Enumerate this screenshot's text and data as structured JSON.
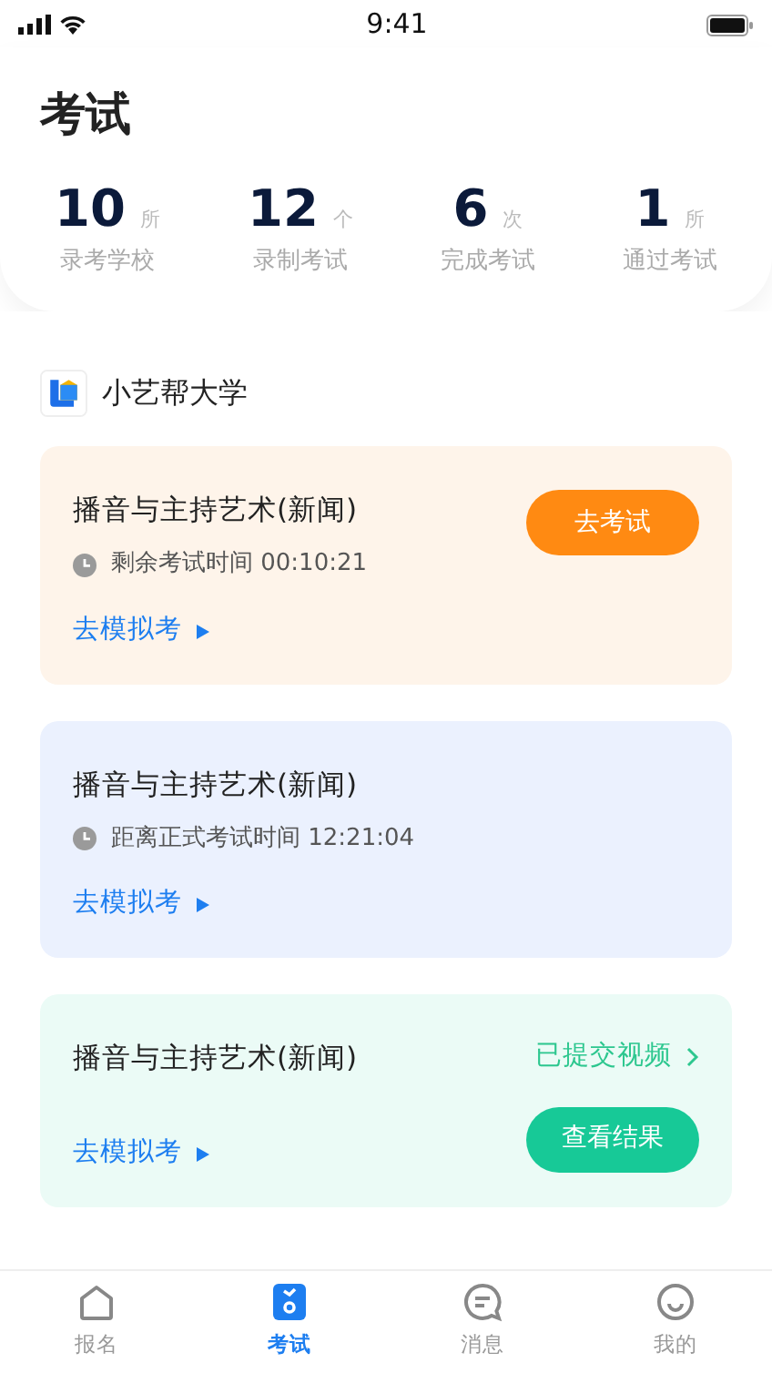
{
  "status_bar": {
    "time": "9:41"
  },
  "title": "考试",
  "stats": [
    {
      "value": "10",
      "unit": "所",
      "label": "录考学校"
    },
    {
      "value": "12",
      "unit": "个",
      "label": "录制考试"
    },
    {
      "value": "6",
      "unit": "次",
      "label": "完成考试"
    },
    {
      "value": "1",
      "unit": "所",
      "label": "通过考试"
    }
  ],
  "school": {
    "name": "小艺帮大学"
  },
  "exams": [
    {
      "kind": "ongoing",
      "title": "播音与主持艺术(新闻)",
      "timer": "剩余考试时间 00:10:21",
      "mock_link": "去模拟考",
      "button": "去考试"
    },
    {
      "kind": "upcoming",
      "title": "播音与主持艺术(新闻)",
      "timer": "距离正式考试时间 12:21:04",
      "mock_link": "去模拟考"
    },
    {
      "kind": "submitted",
      "title": "播音与主持艺术(新闻)",
      "status_link": "已提交视频",
      "mock_link": "去模拟考",
      "button": "查看结果"
    }
  ],
  "tabs": [
    {
      "label": "报名",
      "selected": false
    },
    {
      "label": "考试",
      "selected": true
    },
    {
      "label": "消息",
      "selected": false
    },
    {
      "label": "我的",
      "selected": false
    }
  ]
}
